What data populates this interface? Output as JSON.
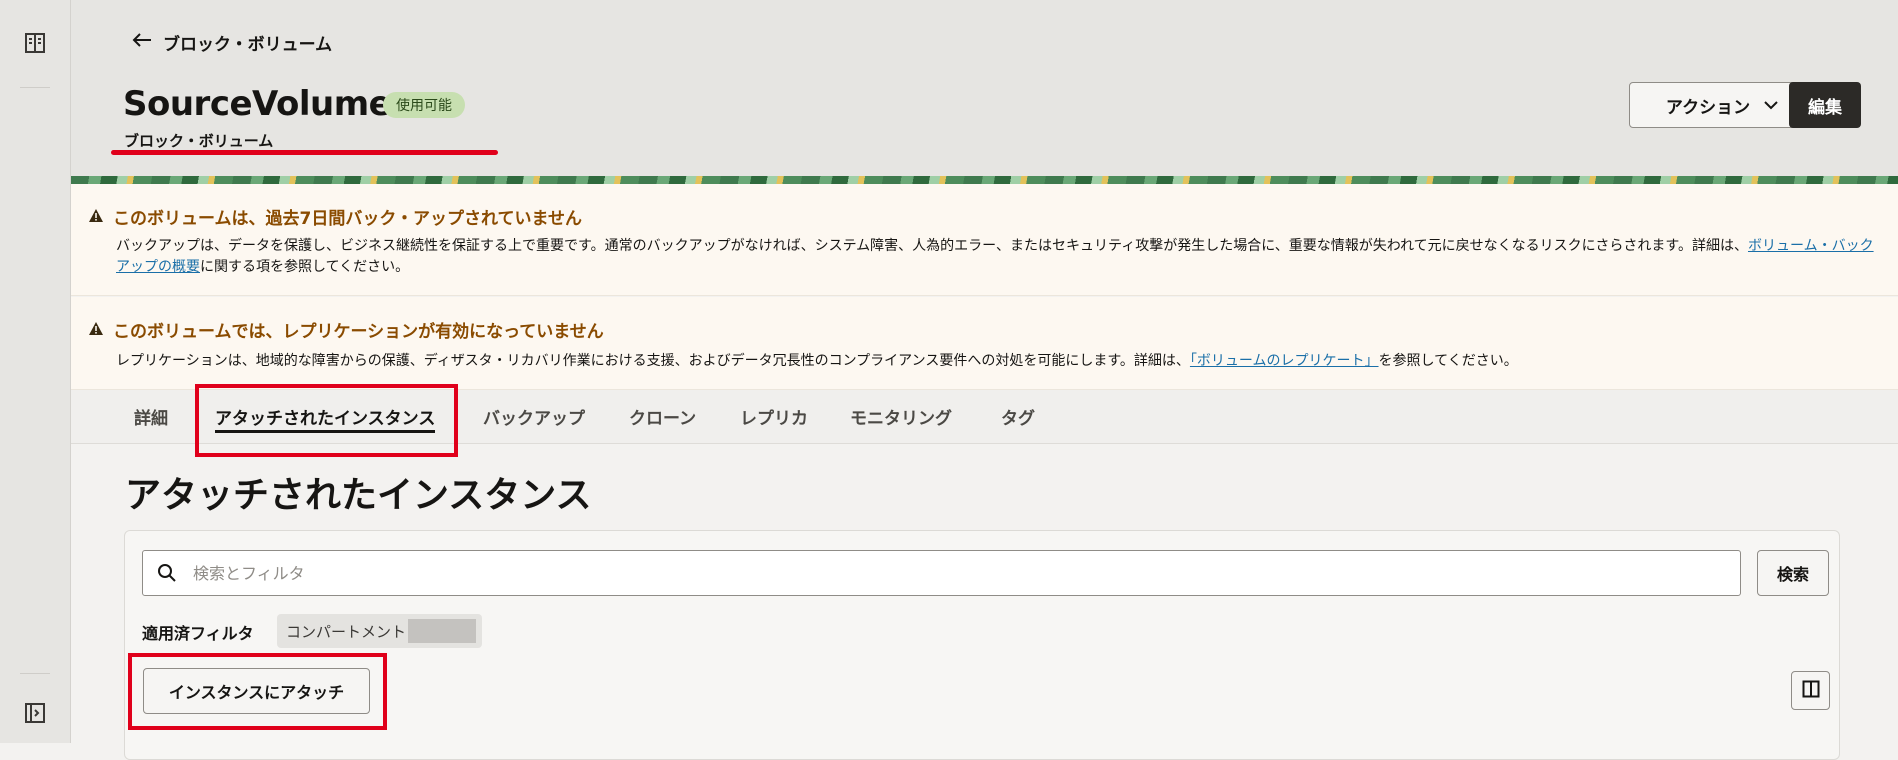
{
  "header": {
    "back_label": "ブロック・ボリューム",
    "title": "SourceVolume",
    "status_badge": "使用可能",
    "subtitle": "ブロック・ボリューム",
    "actions_label": "アクション",
    "edit_label": "編集"
  },
  "alerts": [
    {
      "title": "このボリュームは、過去7日間バック・アップされていません",
      "text_before": "バックアップは、データを保護し、ビジネス継続性を保証する上で重要です。通常のバックアップがなければ、システム障害、人為的エラー、またはセキュリティ攻撃が発生した場合に、重要な情報が失われて元に戻せなくなるリスクにさらされます。詳細は、",
      "link": "ボリューム・バックアップの概要",
      "text_after": "に関する項を参照してください。"
    },
    {
      "title": "このボリュームでは、レプリケーションが有効になっていません",
      "text_before": "レプリケーションは、地域的な障害からの保護、ディザスタ・リカバリ作業における支援、およびデータ冗長性のコンプライアンス要件への対処を可能にします。詳細は、",
      "link": "「ボリュームのレプリケート」",
      "text_after": "を参照してください。"
    }
  ],
  "tabs": [
    {
      "label": "詳細"
    },
    {
      "label": "アタッチされたインスタンス",
      "active": true
    },
    {
      "label": "バックアップ"
    },
    {
      "label": "クローン"
    },
    {
      "label": "レプリカ"
    },
    {
      "label": "モニタリング"
    },
    {
      "label": "タグ"
    }
  ],
  "main": {
    "section_title": "アタッチされたインスタンス",
    "search_placeholder": "検索とフィルタ",
    "search_button": "検索",
    "applied_filters_label": "適用済フィルタ",
    "filter_chip_label": "コンパートメント",
    "attach_button": "インスタンスにアタッチ"
  },
  "colors": {
    "accent_red": "#e0001b",
    "warning_text": "#8a4b00",
    "badge_bg": "#c7dfb0",
    "edit_bg": "#2c2a27"
  },
  "icons": [
    "panel-layout-icon",
    "sidebar-expand-icon",
    "back-arrow-icon",
    "chevron-down-icon",
    "warning-icon",
    "search-icon",
    "columns-icon"
  ]
}
